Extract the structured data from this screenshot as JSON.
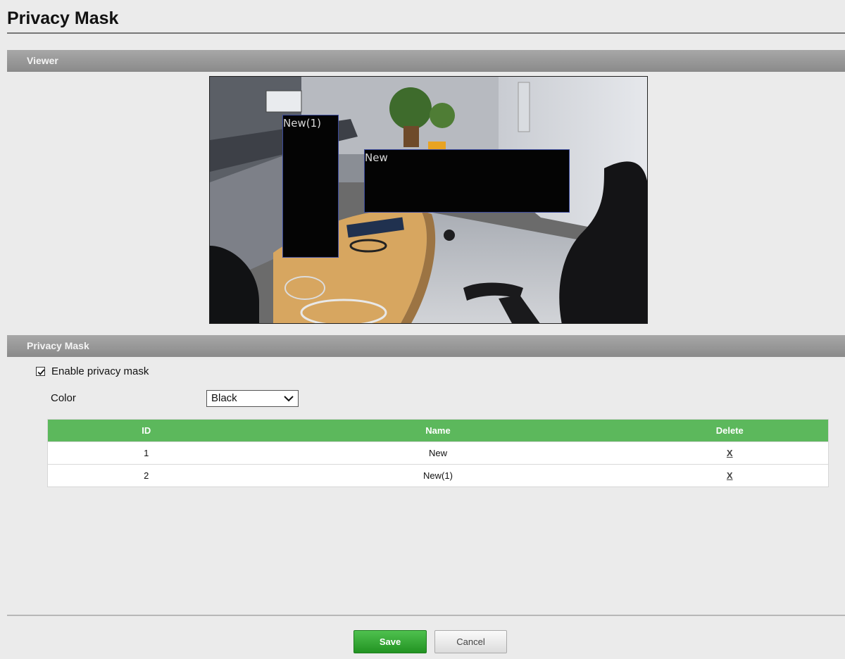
{
  "page": {
    "title": "Privacy Mask"
  },
  "sections": {
    "viewer": "Viewer",
    "privacy_mask": "Privacy Mask"
  },
  "viewer": {
    "masks": [
      {
        "label": "New(1)"
      },
      {
        "label": "New"
      }
    ]
  },
  "settings": {
    "enable_label": "Enable privacy mask",
    "enabled": true,
    "color_label": "Color",
    "color_value": "Black"
  },
  "table": {
    "headers": {
      "id": "ID",
      "name": "Name",
      "delete": "Delete"
    },
    "rows": [
      {
        "id": "1",
        "name": "New",
        "delete": "X"
      },
      {
        "id": "2",
        "name": "New(1)",
        "delete": "X"
      }
    ]
  },
  "buttons": {
    "save": "Save",
    "cancel": "Cancel"
  },
  "colors": {
    "header_green": "#5cb85c",
    "save_green": "#2ea52e",
    "section_gray": "#9a9a9a"
  }
}
